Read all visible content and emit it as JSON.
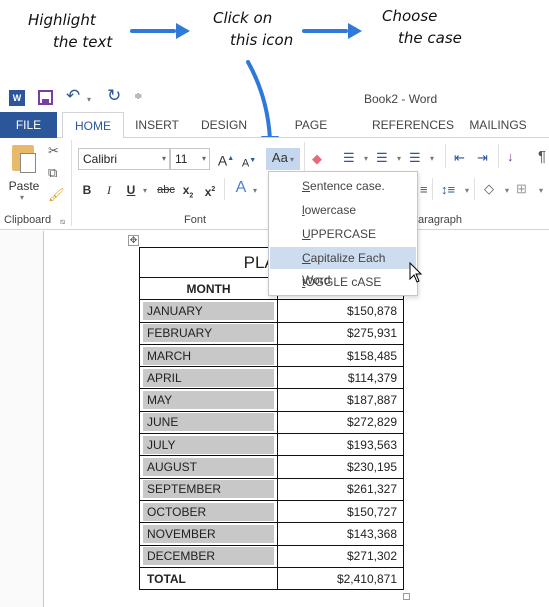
{
  "instructions": {
    "step1": [
      "Highlight",
      "the text"
    ],
    "step2": [
      "Click on",
      "this icon"
    ],
    "step3": [
      "Choose",
      "the case"
    ],
    "arrow_color": "#2f7ad8"
  },
  "titlebar": {
    "title": "Book2 - Word",
    "qat": [
      "word-logo",
      "save",
      "undo",
      "redo",
      "customize"
    ]
  },
  "tabs": [
    "FILE",
    "HOME",
    "INSERT",
    "DESIGN",
    "PAGE LAYOUT",
    "REFERENCES",
    "MAILINGS"
  ],
  "active_tab": "HOME",
  "accent_color": "#2b579a",
  "ribbon": {
    "clipboard": {
      "paste_label": "Paste",
      "group_label": "Clipboard"
    },
    "font": {
      "font_name": "Calibri",
      "font_size": "11",
      "group_label": "Font",
      "change_case_label": "Aa"
    },
    "paragraph": {
      "group_label": "aragraph"
    }
  },
  "change_case_menu": {
    "items": [
      {
        "accel": "S",
        "rest": "entence case."
      },
      {
        "accel": "l",
        "rest": "owercase"
      },
      {
        "accel": "U",
        "rest": "PPERCASE"
      },
      {
        "accel": "C",
        "rest": "apitalize Each Word"
      },
      {
        "accel": "t",
        "rest": "OGGLE cASE"
      }
    ],
    "highlighted": "Capitalize Each Word"
  },
  "table": {
    "title": "PLANE",
    "header": "MONTH",
    "rows": [
      {
        "month": "JANUARY",
        "value": "$150,878"
      },
      {
        "month": "FEBRUARY",
        "value": "$275,931"
      },
      {
        "month": "MARCH",
        "value": "$158,485"
      },
      {
        "month": "APRIL",
        "value": "$114,379"
      },
      {
        "month": "MAY",
        "value": "$187,887"
      },
      {
        "month": "JUNE",
        "value": "$272,829"
      },
      {
        "month": "JULY",
        "value": "$193,563"
      },
      {
        "month": "AUGUST",
        "value": "$230,195"
      },
      {
        "month": "SEPTEMBER",
        "value": "$261,327"
      },
      {
        "month": "OCTOBER",
        "value": "$150,727"
      },
      {
        "month": "NOVEMBER",
        "value": "$143,368"
      },
      {
        "month": "DECEMBER",
        "value": "$271,302"
      }
    ],
    "total_label": "TOTAL",
    "total_value": "$2,410,871"
  }
}
